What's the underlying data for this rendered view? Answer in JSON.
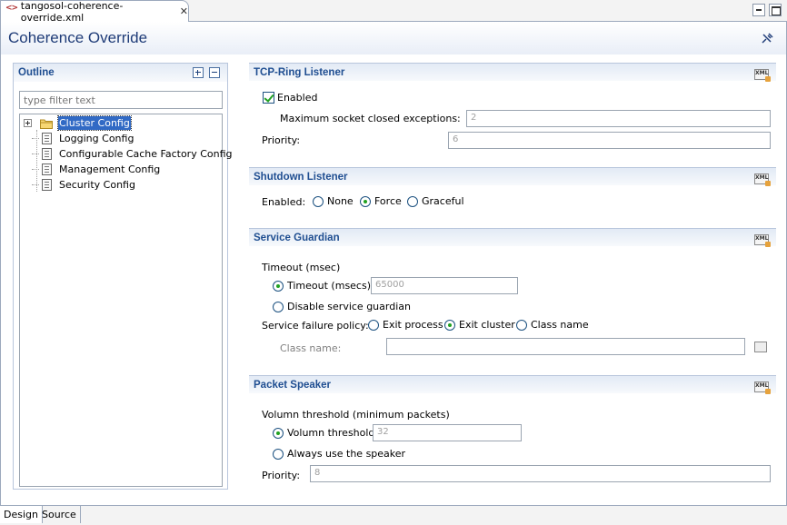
{
  "tab": {
    "title": "tangosol-coherence-override.xml",
    "close": "✕"
  },
  "page": {
    "title": "Coherence Override"
  },
  "outline": {
    "title": "Outline",
    "filter_placeholder": "type filter text",
    "items": [
      {
        "label": "Cluster Config"
      },
      {
        "label": "Logging Config"
      },
      {
        "label": "Configurable Cache Factory Config"
      },
      {
        "label": "Management Config"
      },
      {
        "label": "Security Config"
      }
    ]
  },
  "tcp_ring": {
    "title": "TCP-Ring Listener",
    "enabled_label": "Enabled",
    "max_socket_label": "Maximum socket closed exceptions:",
    "max_socket_value": "2",
    "priority_label": "Priority:",
    "priority_value": "6"
  },
  "shutdown": {
    "title": "Shutdown Listener",
    "enabled_label": "Enabled:",
    "options": [
      "None",
      "Force",
      "Graceful"
    ],
    "selected": "Force"
  },
  "guardian": {
    "title": "Service Guardian",
    "timeout_group": "Timeout (msec)",
    "timeout_label": "Timeout (msecs):",
    "timeout_value": "65000",
    "disable_label": "Disable service guardian",
    "policy_label": "Service failure policy:",
    "policy_options": [
      "Exit process",
      "Exit cluster",
      "Class name"
    ],
    "policy_selected": "Exit cluster",
    "class_label": "Class name:",
    "class_value": ""
  },
  "speaker": {
    "title": "Packet Speaker",
    "threshold_group": "Volumn threshold (minimum packets)",
    "threshold_label": "Volumn threshold:",
    "threshold_value": "32",
    "always_label": "Always use the speaker",
    "priority_label": "Priority:",
    "priority_value": "8"
  },
  "bottom_tabs": [
    "Design",
    "Source"
  ]
}
